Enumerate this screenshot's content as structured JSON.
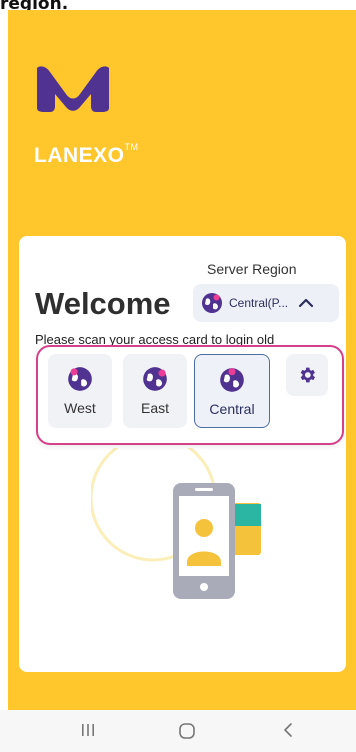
{
  "header_text": "region.",
  "brand": {
    "name": "LANEXO",
    "tm": "TM"
  },
  "card": {
    "server_region_label": "Server Region",
    "selected_region": "Central(P...",
    "welcome_title": "Welcome",
    "scan_text": "Please scan your access card to login  old"
  },
  "region_popup": {
    "options": [
      {
        "label": "West",
        "icon": "globe-icon"
      },
      {
        "label": "East",
        "icon": "globe-icon"
      },
      {
        "label": "Central",
        "icon": "globe-icon",
        "selected": true
      }
    ],
    "settings_icon": "gear-icon"
  },
  "navbar": {
    "recents": "|||",
    "home": "▢",
    "back": "<"
  },
  "colors": {
    "brand_yellow": "#ffc72c",
    "brand_purple": "#503291",
    "highlight_pink": "#d4418a",
    "accent_pink": "#eb3c96"
  }
}
